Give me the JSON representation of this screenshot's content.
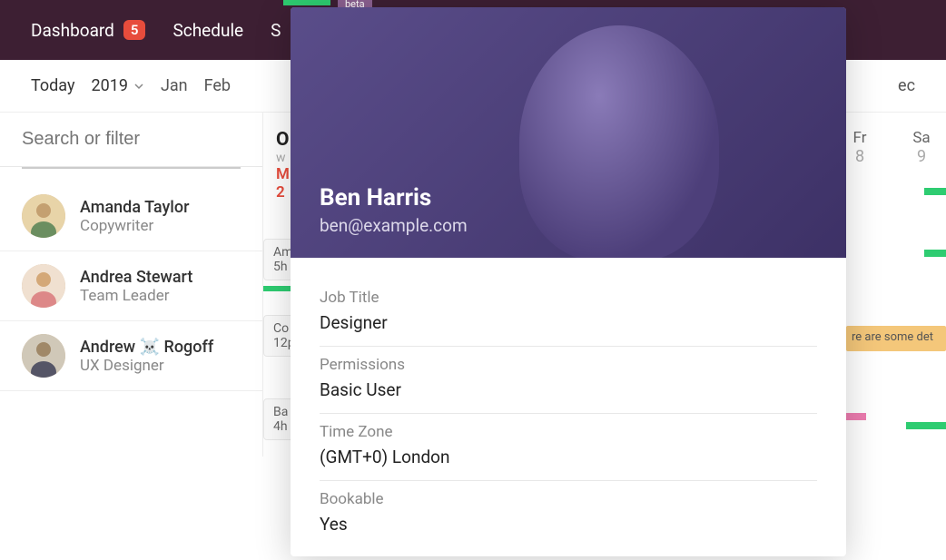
{
  "topbar": {
    "items": [
      {
        "label": "Dashboard",
        "badge": "5"
      },
      {
        "label": "Schedule"
      },
      {
        "label": "S",
        "beta": "beta"
      }
    ]
  },
  "datebar": {
    "today": "Today",
    "year": "2019",
    "months_left": [
      "Jan",
      "Feb"
    ],
    "months_right": [
      "ec"
    ]
  },
  "search": {
    "placeholder": "Search or filter"
  },
  "people": [
    {
      "name": "Amanda Taylor",
      "role": "Copywriter"
    },
    {
      "name": "Andrea Stewart",
      "role": "Team Leader"
    },
    {
      "name": "Andrew ☠️ Rogoff",
      "role": "UX Designer"
    }
  ],
  "schedule": {
    "month_title": "O",
    "week_label": "w",
    "red_day_top": "M",
    "red_day_bottom": "2",
    "tasks": [
      {
        "t1": "Am",
        "t2": "5h"
      },
      {
        "t1": "Co",
        "t2": "12p"
      },
      {
        "t1": "Ba",
        "t2": "4h"
      }
    ]
  },
  "right_days": [
    {
      "dow": "Fr",
      "num": "8"
    },
    {
      "dow": "Sa",
      "num": "9"
    }
  ],
  "right_event": "re are some det",
  "profile": {
    "name": "Ben Harris",
    "email": "ben@example.com",
    "fields": [
      {
        "label": "Job Title",
        "value": "Designer"
      },
      {
        "label": "Permissions",
        "value": "Basic User"
      },
      {
        "label": "Time Zone",
        "value": "(GMT+0) London"
      },
      {
        "label": "Bookable",
        "value": "Yes"
      }
    ]
  }
}
